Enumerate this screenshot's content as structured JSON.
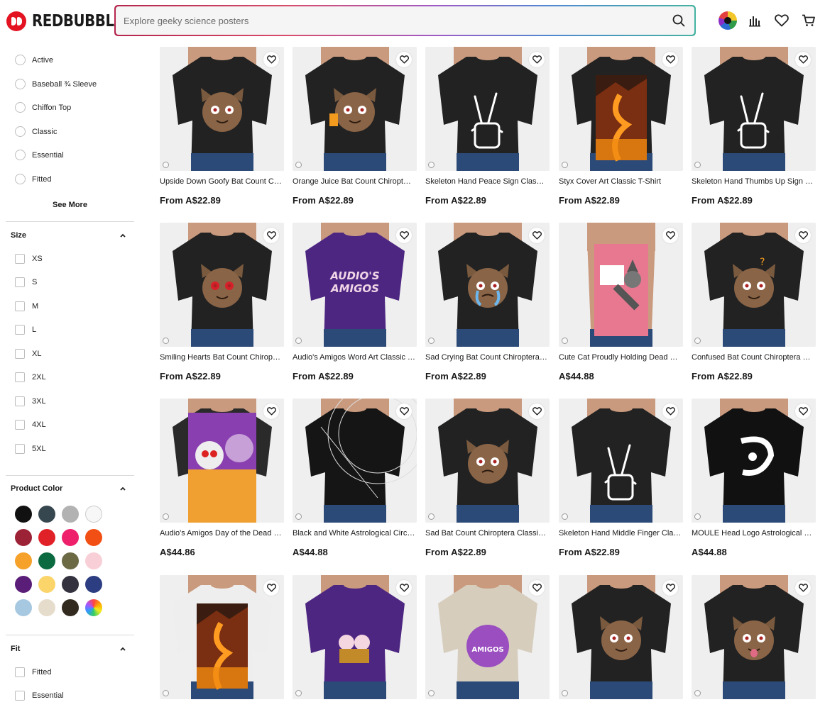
{
  "brand": {
    "name": "REDBUBBLE"
  },
  "search": {
    "placeholder": "Explore geeky science posters"
  },
  "header_icons": [
    "avatar",
    "bar-chart-icon",
    "heart-icon",
    "cart-icon"
  ],
  "sidebar": {
    "styles": [
      "Active",
      "Baseball ¾ Sleeve",
      "Chiffon Top",
      "Classic",
      "Essential",
      "Fitted"
    ],
    "see_more": "See More",
    "size": {
      "title": "Size",
      "options": [
        "XS",
        "S",
        "M",
        "L",
        "XL",
        "2XL",
        "3XL",
        "4XL",
        "5XL"
      ]
    },
    "color": {
      "title": "Product Color",
      "swatches": [
        "#111111",
        "#37474f",
        "#b2b2b2",
        "#f7f7f7",
        "#9c2236",
        "#e02127",
        "#ee1f6b",
        "#f24f14",
        "#f5a12a",
        "#0b6a3f",
        "#6b6a45",
        "#f9cfd7",
        "#5a1d78",
        "#fbd46a",
        "#33323e",
        "#2c3d82",
        "#a6c8e0",
        "#e6dccb",
        "#332a1f",
        "rainbow"
      ]
    },
    "fit": {
      "title": "Fit",
      "options": [
        "Fitted",
        "Essential"
      ]
    }
  },
  "products": [
    {
      "title": "Upside Down Goofy Bat Count Chiroptera Classic T-Shirt",
      "price": "From A$22.89",
      "shirt": "#222222",
      "bg": "#efefef",
      "art": "bat-upside"
    },
    {
      "title": "Orange Juice Bat Count Chiroptera Classic T-Shirt",
      "price": "From A$22.89",
      "shirt": "#222222",
      "bg": "#efefef",
      "art": "bat-juice"
    },
    {
      "title": "Skeleton Hand Peace Sign Classic T-Shirt",
      "price": "From A$22.89",
      "shirt": "#222222",
      "bg": "#efefef",
      "art": "hand-peace"
    },
    {
      "title": "Styx Cover Art Classic T-Shirt",
      "price": "From A$22.89",
      "shirt": "#222222",
      "bg": "#efefef",
      "art": "styx"
    },
    {
      "title": "Skeleton Hand Thumbs Up Sign Classic T-Shirt",
      "price": "From A$22.89",
      "shirt": "#222222",
      "bg": "#efefef",
      "art": "hand-thumb"
    },
    {
      "title": "Smiling Hearts Bat Count Chiroptera Classic T-Shirt",
      "price": "From A$22.89",
      "shirt": "#222222",
      "bg": "#efefef",
      "art": "bat-hearts"
    },
    {
      "title": "Audio's Amigos Word Art Classic T-Shirt",
      "price": "From A$22.89",
      "shirt": "#4d2682",
      "bg": "#efefef",
      "art": "amigos-word"
    },
    {
      "title": "Sad Crying Bat Count Chiroptera Classic T-Shirt",
      "price": "From A$22.89",
      "shirt": "#222222",
      "bg": "#efefef",
      "art": "bat-cry"
    },
    {
      "title": "Cute Cat Proudly Holding Dead Mouse Tank Top",
      "price": "A$44.88",
      "shirt": "#e5768e",
      "bg": "#efefef",
      "art": "cat-tank"
    },
    {
      "title": "Confused Bat Count Chiroptera Classic T-Shirt",
      "price": "From A$22.89",
      "shirt": "#222222",
      "bg": "#efefef",
      "art": "bat-confused"
    },
    {
      "title": "Audio's Amigos Day of the Dead Graphic T-Shirt",
      "price": "A$44.86",
      "shirt": "#2a2a2a",
      "bg": "#efefef",
      "art": "amigos-dotd"
    },
    {
      "title": "Black and White Astrological Circle Graphic T-Shirt",
      "price": "A$44.88",
      "shirt": "#151515",
      "bg": "#efefef",
      "art": "astro"
    },
    {
      "title": "Sad Bat Count Chiroptera Classic T-Shirt",
      "price": "From A$22.89",
      "shirt": "#222222",
      "bg": "#efefef",
      "art": "bat-sad"
    },
    {
      "title": "Skeleton Hand Middle Finger Classic T-Shirt",
      "price": "From A$22.89",
      "shirt": "#222222",
      "bg": "#efefef",
      "art": "hand-middle"
    },
    {
      "title": "MOULE Head Logo Astrological Chiffon Top",
      "price": "A$44.88",
      "shirt": "#111111",
      "bg": "#efefef",
      "art": "moule"
    },
    {
      "title": "",
      "price": "",
      "shirt": "#eeeeee",
      "bg": "#efefef",
      "art": "styx-white"
    },
    {
      "title": "",
      "price": "",
      "shirt": "#4d2682",
      "bg": "#efefef",
      "art": "amigos-small"
    },
    {
      "title": "",
      "price": "",
      "shirt": "#d6cdbd",
      "bg": "#efefef",
      "art": "amigos-circle"
    },
    {
      "title": "",
      "price": "",
      "shirt": "#222222",
      "bg": "#efefef",
      "art": "bat-laugh"
    },
    {
      "title": "",
      "price": "",
      "shirt": "#222222",
      "bg": "#efefef",
      "art": "bat-tongue"
    }
  ]
}
